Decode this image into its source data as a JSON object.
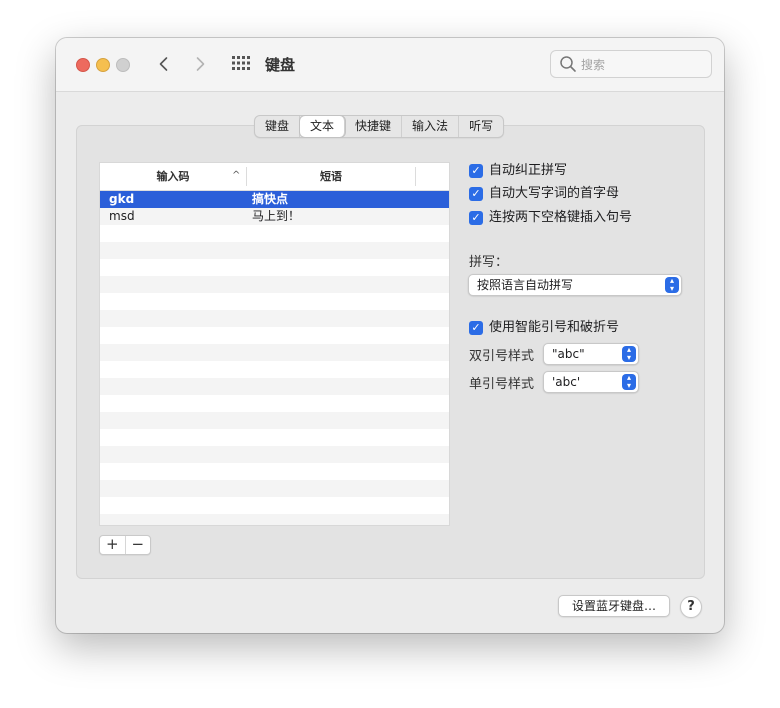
{
  "window": {
    "title": "键盘"
  },
  "search": {
    "placeholder": "搜索"
  },
  "tabs": [
    {
      "label": "键盘",
      "active": false
    },
    {
      "label": "文本",
      "active": true
    },
    {
      "label": "快捷键",
      "active": false
    },
    {
      "label": "输入法",
      "active": false
    },
    {
      "label": "听写",
      "active": false
    }
  ],
  "table": {
    "headers": {
      "input": "输入码",
      "phrase": "短语"
    },
    "rows": [
      {
        "input": "gkd",
        "phrase": "搞快点",
        "selected": true
      },
      {
        "input": "msd",
        "phrase": "马上到！",
        "selected": false
      }
    ]
  },
  "controls": {
    "add": "+",
    "remove": "−"
  },
  "options": {
    "auto_correct": {
      "label": "自动纠正拼写",
      "checked": true
    },
    "auto_capitalize": {
      "label": "自动大写字词的首字母",
      "checked": true
    },
    "double_space_period": {
      "label": "连按两下空格键插入句号",
      "checked": true
    }
  },
  "spelling": {
    "label": "拼写：",
    "value": "按照语言自动拼写"
  },
  "smart_quotes": {
    "label": "使用智能引号和破折号",
    "checked": true
  },
  "double_quote": {
    "label": "双引号样式",
    "value": "\"abc\""
  },
  "single_quote": {
    "label": "单引号样式",
    "value": "'abc'"
  },
  "bluetooth_button": "设置蓝牙键盘…",
  "help": "?",
  "colors": {
    "accent": "#2b6ce6",
    "selection": "#2b5fd9"
  }
}
